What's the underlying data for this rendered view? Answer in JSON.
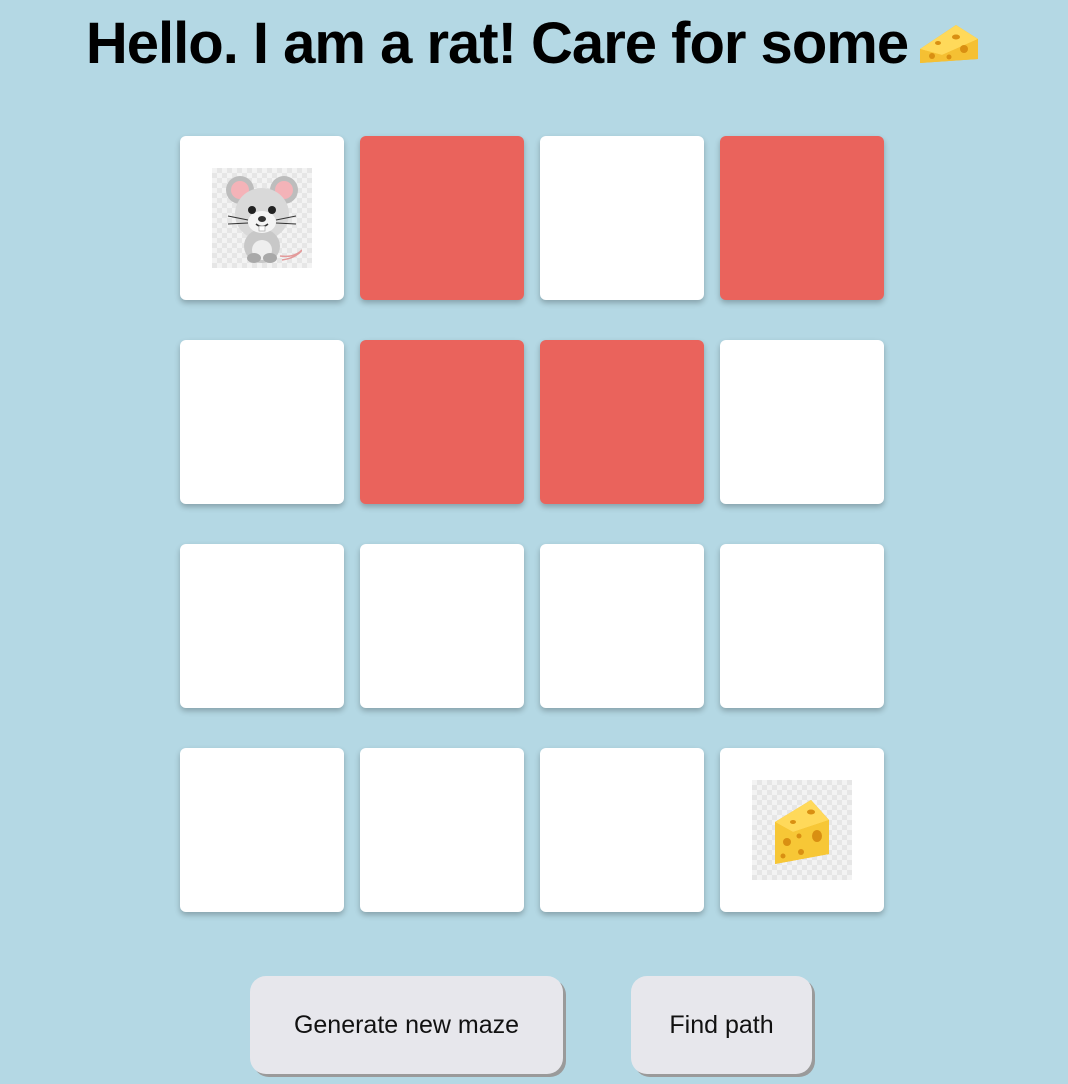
{
  "header": {
    "title": "Hello. I am a rat! Care for some",
    "title_icon": "cheese-icon"
  },
  "maze": {
    "rows": 4,
    "cols": 4,
    "cells": [
      [
        "rat",
        "wall",
        "open",
        "wall"
      ],
      [
        "open",
        "wall",
        "wall",
        "open"
      ],
      [
        "open",
        "open",
        "open",
        "open"
      ],
      [
        "open",
        "open",
        "open",
        "cheese"
      ]
    ],
    "colors": {
      "wall": "#ea635c",
      "open": "#ffffff",
      "background": "#b4d8e4"
    }
  },
  "controls": {
    "generate_label": "Generate new maze",
    "find_label": "Find path"
  }
}
